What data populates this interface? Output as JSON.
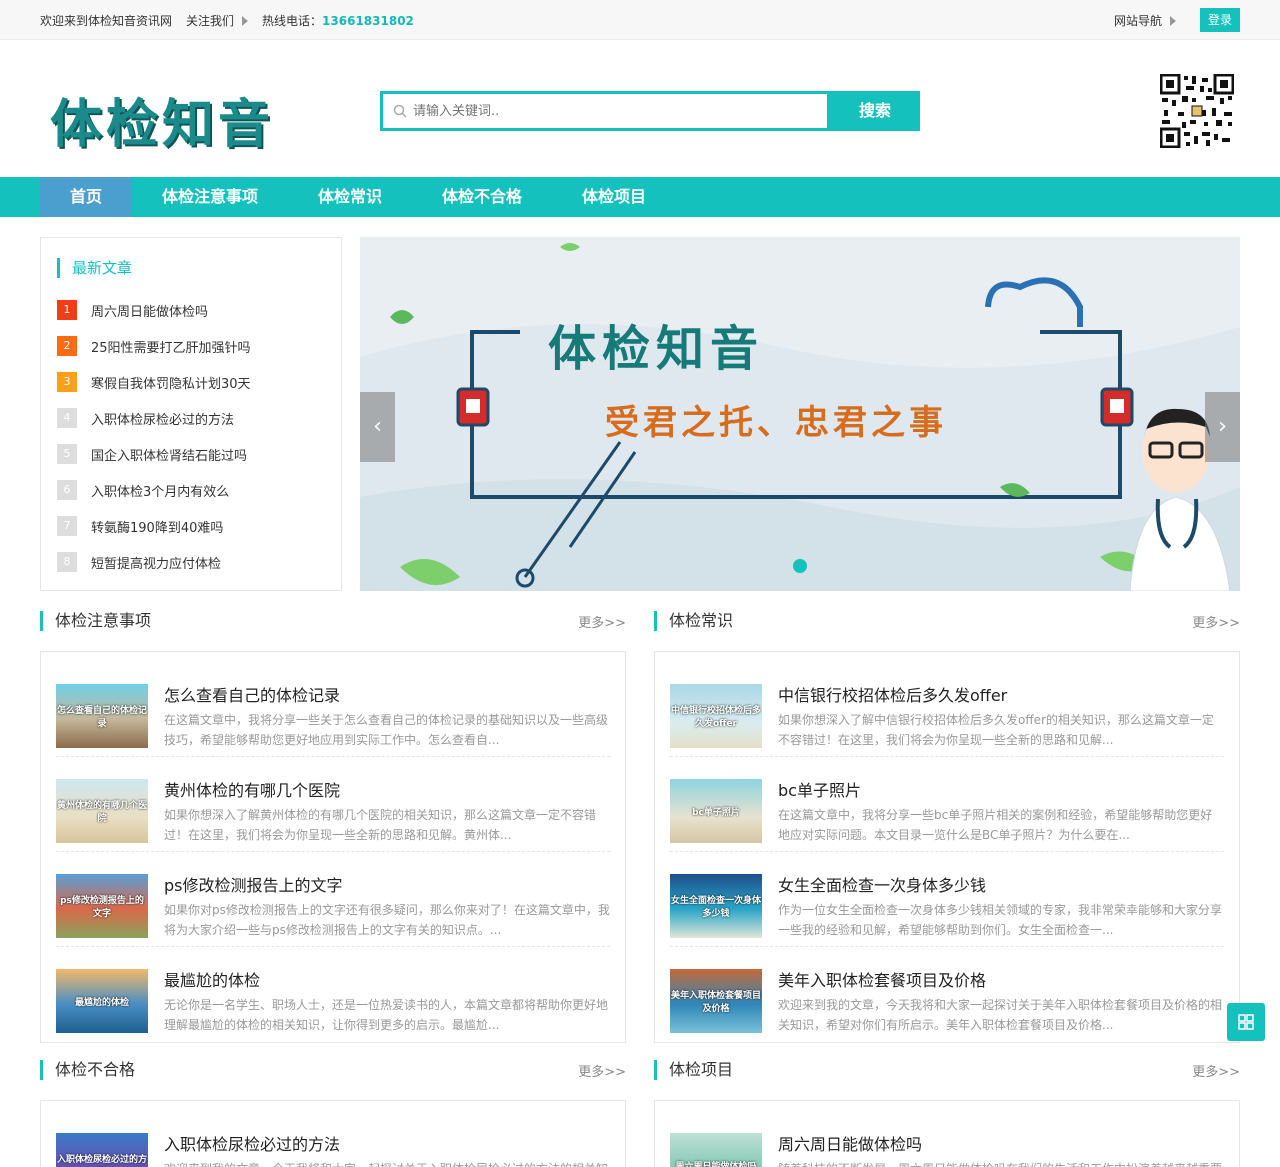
{
  "topbar": {
    "welcome": "欢迎来到体检知音资讯网",
    "follow": "关注我们",
    "hotline_label": "热线电话：",
    "hotline": "13661831802",
    "site_nav": "网站导航",
    "login": "登录"
  },
  "header": {
    "logo": "体检知音",
    "search_placeholder": "请输入关键词..",
    "search_button": "搜索"
  },
  "nav": {
    "items": [
      "首页",
      "体检注意事项",
      "体检常识",
      "体检不合格",
      "体检项目"
    ]
  },
  "latest": {
    "title": "最新文章",
    "items": [
      {
        "num": "1",
        "title": "周六周日能做体检吗",
        "color": "#f23c1a"
      },
      {
        "num": "2",
        "title": "25阳性需要打乙肝加强针吗",
        "color": "#fa6b13"
      },
      {
        "num": "3",
        "title": "寒假自我体罚隐私计划30天",
        "color": "#f8a01a"
      },
      {
        "num": "4",
        "title": "入职体检尿检必过的方法",
        "color": "#dddddd"
      },
      {
        "num": "5",
        "title": "国企入职体检肾结石能过吗",
        "color": "#dddddd"
      },
      {
        "num": "6",
        "title": "入职体检3个月内有效么",
        "color": "#dddddd"
      },
      {
        "num": "7",
        "title": "转氨酶190降到40难吗",
        "color": "#dddddd"
      },
      {
        "num": "8",
        "title": "短暂提高视力应付体检",
        "color": "#dddddd"
      }
    ]
  },
  "slider": {
    "title": "体检知音",
    "subtitle": "受君之托、忠君之事",
    "prev": "‹",
    "next": "›"
  },
  "more_label": "更多>>",
  "sections": [
    {
      "title": "体检注意事项",
      "posts": [
        {
          "title": "怎么查看自己的体检记录",
          "excerpt": "在这篇文章中，我将分享一些关于怎么查看自己的体检记录的基础知识以及一些高级技巧，希望能够帮助您更好地应用到实际工作中。怎么查看自...",
          "thumb": "怎么查看自己的体检记录",
          "bg": "linear-gradient(180deg,#6fd0e8 0%,#c5b79a 55%,#8a6a4a 100%)"
        },
        {
          "title": "黄州体检的有哪几个医院",
          "excerpt": "如果你想深入了解黄州体检的有哪几个医院的相关知识，那么这篇文章一定不容错过！在这里，我们将会为你呈现一些全新的思路和见解。黄州体...",
          "thumb": "黄州体检的有哪几个医院",
          "bg": "linear-gradient(180deg,#cfe7ef 0%,#e9dfc4 60%,#d7c49c 100%)"
        },
        {
          "title": "ps修改检测报告上的文字",
          "excerpt": "如果你对ps修改检测报告上的文字还有很多疑问，那么你来对了！在这篇文章中，我将为大家介绍一些与ps修改检测报告上的文字有关的知识点。...",
          "thumb": "ps修改检测报告上的文字",
          "bg": "linear-gradient(180deg,#5a9ed6 0%,#d86a4a 55%,#8aa35a 100%)"
        },
        {
          "title": "最尴尬的体检",
          "excerpt": "无论你是一名学生、职场人士，还是一位热爱读书的人，本篇文章都将帮助你更好地理解最尴尬的体检的相关知识，让你得到更多的启示。最尴尬...",
          "thumb": "最尴尬的体检",
          "bg": "linear-gradient(180deg,#f2b96a 0%,#4a8ec4 55%,#1e5f8e 100%)"
        }
      ]
    },
    {
      "title": "体检常识",
      "posts": [
        {
          "title": "中信银行校招体检后多久发offer",
          "excerpt": "如果你想深入了解中信银行校招体检后多久发offer的相关知识，那么这篇文章一定不容错过！在这里，我们将会为你呈现一些全新的思路和见解...",
          "thumb": "中信银行校招体检后多久发offer",
          "bg": "linear-gradient(180deg,#a9d7e6 0%,#d8ecef 60%,#e6e0c8 100%)"
        },
        {
          "title": "bc单子照片",
          "excerpt": "在这篇文章中，我将分享一些bc单子照片相关的案例和经验，希望能够帮助您更好地应对实际问题。本文目录一览什么是BC单子照片？为什么要在...",
          "thumb": "bc单子照片",
          "bg": "linear-gradient(180deg,#8fd4e0 0%,#e7e2cf 60%,#d6c6a4 100%)"
        },
        {
          "title": "女生全面检查一次身体多少钱",
          "excerpt": "作为一位女生全面检查一次身体多少钱相关领域的专家，我非常荣幸能够和大家分享一些我的经验和见解，希望能够帮助到你们。女生全面检查一...",
          "thumb": "女生全面检查一次身体多少钱",
          "bg": "linear-gradient(180deg,#1c4f8c 0%,#2aa6c8 55%,#e2e6d8 100%)"
        },
        {
          "title": "美年入职体检套餐项目及价格",
          "excerpt": "欢迎来到我的文章，今天我将和大家一起探讨关于美年入职体检套餐项目及价格的相关知识，希望对你们有所启示。美年入职体检套餐项目及价格...",
          "thumb": "美年入职体检套餐项目及价格",
          "bg": "linear-gradient(180deg,#c56a3a 0%,#2f86b8 55%,#7ac2d8 100%)"
        }
      ]
    },
    {
      "title": "体检不合格",
      "posts": [
        {
          "title": "入职体检尿检必过的方法",
          "excerpt": "欢迎来到我的文章，今天我将和大家一起探讨关于入职体检尿检必过的方法的相关知",
          "thumb": "入职体检尿检必过的方法",
          "bg": "linear-gradient(180deg,#3a7bc8 0%,#6a4ab0 60%,#c8b08a 100%)"
        }
      ]
    },
    {
      "title": "体检项目",
      "posts": [
        {
          "title": "周六周日能做体检吗",
          "excerpt": "随着科技的不断发展，周六周日能做体检吗在我们的生活和工作中扮演着越来越重要",
          "thumb": "周六周日能做体检吗",
          "bg": "linear-gradient(180deg,#bfe0d8 0%,#7ec8b0 60%,#4a9a7a 100%)"
        }
      ]
    }
  ]
}
